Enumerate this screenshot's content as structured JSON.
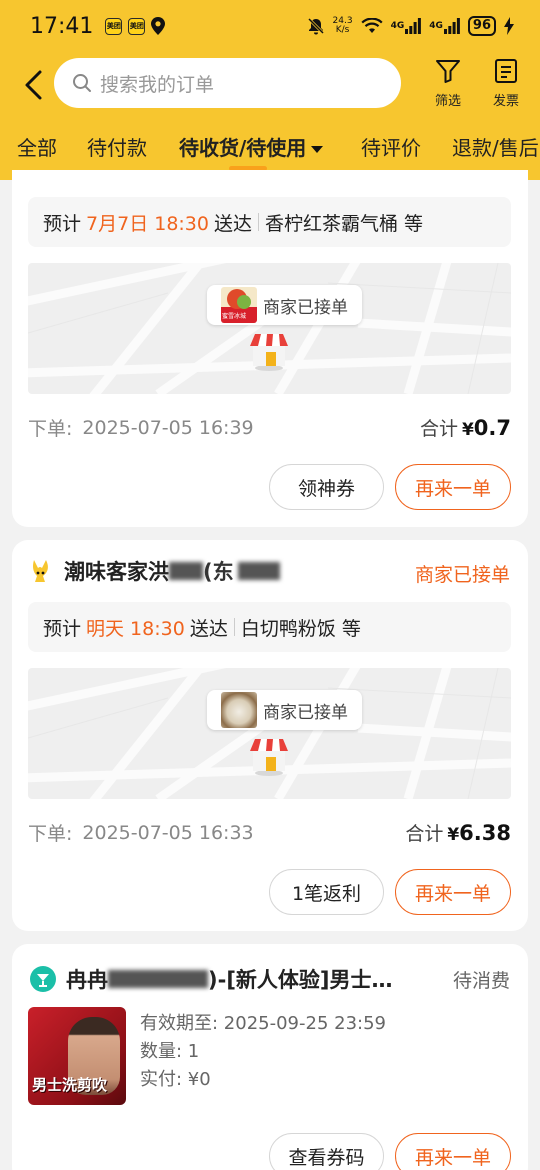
{
  "status_bar": {
    "time": "17:41",
    "apps": [
      "美团",
      "美团"
    ],
    "net_speed_value": "24.3",
    "net_speed_unit": "K/s",
    "signal_1": "4G",
    "signal_2": "4G",
    "battery": "96"
  },
  "header": {
    "search_placeholder": "搜索我的订单",
    "filter_label": "筛选",
    "invoice_label": "发票"
  },
  "tabs": [
    {
      "label": "全部"
    },
    {
      "label": "待付款"
    },
    {
      "label": "待收货/待使用",
      "active": true
    },
    {
      "label": "待评价"
    },
    {
      "label": "退款/售后"
    }
  ],
  "orders": [
    {
      "eta_prefix": "预计",
      "eta_time": "7月7日 18:30",
      "eta_suffix": "送达",
      "items": "香柠红茶霸气桶 等",
      "map_status": "商家已接单",
      "thumb_label": "蜜雪冰城",
      "order_time_label": "下单:",
      "order_time": "2025-07-05 16:39",
      "total_label": "合计",
      "currency": "¥",
      "amount": "0.7",
      "btn_secondary": "领神券",
      "btn_primary": "再来一单"
    },
    {
      "shop_name": "潮味客家洪",
      "shop_name_tail": "(东",
      "status": "商家已接单",
      "eta_prefix": "预计",
      "eta_time": "明天 18:30",
      "eta_suffix": "送达",
      "items": "白切鸭粉饭 等",
      "map_status": "商家已接单",
      "order_time_label": "下单:",
      "order_time": "2025-07-05 16:33",
      "total_label": "合计",
      "currency": "¥",
      "amount": "6.38",
      "btn_secondary": "1笔返利",
      "btn_primary": "再来一单"
    },
    {
      "shop_name_prefix": "冉冉",
      "shop_name_mid": ")-[新人体验]男士…",
      "status": "待消费",
      "image_text": "男士洗剪吹",
      "valid_until": "有效期至: 2025-09-25 23:59",
      "quantity": "数量: 1",
      "paid": "实付: ¥0",
      "btn_secondary": "查看券码",
      "btn_primary": "再来一单"
    }
  ],
  "colors": {
    "brand_yellow": "#f7c62f",
    "accent_orange": "#f0641e",
    "tab_underline": "#f9a11b",
    "background": "#f2f2f2"
  }
}
